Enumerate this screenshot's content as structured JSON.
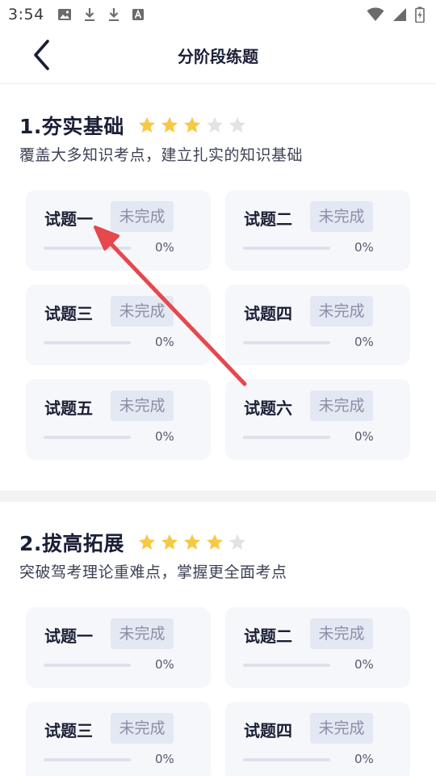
{
  "status_bar": {
    "time": "3:54",
    "left_icons": [
      "image-icon",
      "download-icon",
      "download-icon",
      "font-icon"
    ],
    "right_icons": [
      "wifi-icon",
      "signal-icon",
      "battery-icon"
    ]
  },
  "header": {
    "title": "分阶段练题",
    "back_icon": "chevron-left-icon"
  },
  "colors": {
    "star_filled": "#f6c944",
    "star_empty": "#e3e3e6",
    "card_bg": "#f6f7fa",
    "badge_bg": "#e4e8f3",
    "badge_text": "#8a8fa6",
    "arrow": "#e5484d"
  },
  "sections": [
    {
      "title": "1.夯实基础",
      "rating": 3,
      "rating_max": 5,
      "description": "覆盖大多知识考点，建立扎实的知识基础",
      "exercises": [
        {
          "name": "试题一",
          "status": "未完成",
          "progress_text": "0%",
          "progress": 0
        },
        {
          "name": "试题二",
          "status": "未完成",
          "progress_text": "0%",
          "progress": 0
        },
        {
          "name": "试题三",
          "status": "未完成",
          "progress_text": "0%",
          "progress": 0
        },
        {
          "name": "试题四",
          "status": "未完成",
          "progress_text": "0%",
          "progress": 0
        },
        {
          "name": "试题五",
          "status": "未完成",
          "progress_text": "0%",
          "progress": 0
        },
        {
          "name": "试题六",
          "status": "未完成",
          "progress_text": "0%",
          "progress": 0
        }
      ]
    },
    {
      "title": "2.拔高拓展",
      "rating": 4,
      "rating_max": 5,
      "description": "突破驾考理论重难点，掌握更全面考点",
      "exercises": [
        {
          "name": "试题一",
          "status": "未完成",
          "progress_text": "0%",
          "progress": 0
        },
        {
          "name": "试题二",
          "status": "未完成",
          "progress_text": "0%",
          "progress": 0
        },
        {
          "name": "试题三",
          "status": "未完成",
          "progress_text": "0%",
          "progress": 0
        },
        {
          "name": "试题四",
          "status": "未完成",
          "progress_text": "0%",
          "progress": 0
        }
      ]
    }
  ]
}
